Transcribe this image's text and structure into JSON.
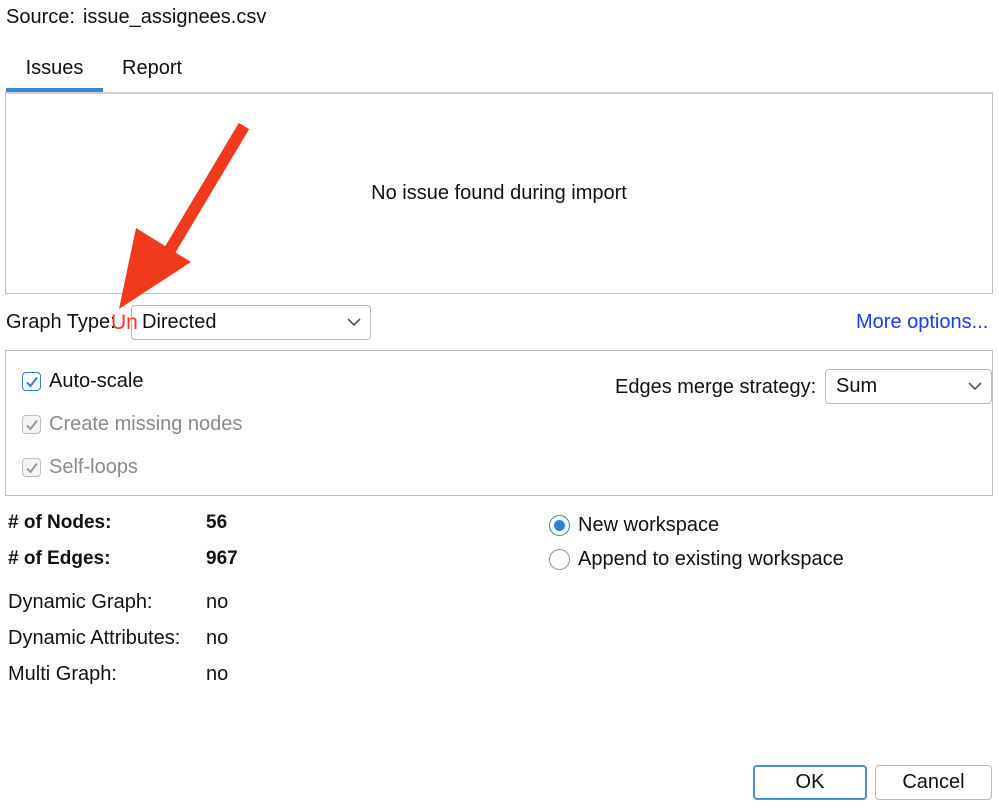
{
  "source": {
    "label": "Source:",
    "file": "issue_assignees.csv"
  },
  "tabs": [
    {
      "label": "Issues",
      "active": true
    },
    {
      "label": "Report",
      "active": false
    }
  ],
  "issues_panel": {
    "message": "No issue found during import"
  },
  "graph_type": {
    "label": "Graph Type:",
    "annotation": "Un",
    "value": "Directed"
  },
  "more_options": "More options...",
  "options": {
    "auto_scale": {
      "label": "Auto-scale",
      "checked": true,
      "enabled": true
    },
    "create_missing_nodes": {
      "label": "Create missing nodes",
      "checked": true,
      "enabled": false
    },
    "self_loops": {
      "label": "Self-loops",
      "checked": true,
      "enabled": false
    },
    "edges_merge": {
      "label": "Edges merge strategy:",
      "value": "Sum"
    }
  },
  "stats": {
    "nodes_label": "# of Nodes:",
    "nodes": "56",
    "edges_label": "# of Edges:",
    "edges": "967",
    "dynamic_graph_label": "Dynamic Graph:",
    "dynamic_graph": "no",
    "dynamic_attributes_label": "Dynamic Attributes:",
    "dynamic_attributes": "no",
    "multi_graph_label": "Multi Graph:",
    "multi_graph": "no"
  },
  "workspace": {
    "new": {
      "label": "New workspace",
      "selected": true
    },
    "append": {
      "label": "Append to existing workspace",
      "selected": false
    }
  },
  "buttons": {
    "ok": "OK",
    "cancel": "Cancel"
  },
  "colors": {
    "accent": "#2f7fd6",
    "link": "#1a3cf0",
    "annotation": "#f03a1e"
  },
  "icons": {
    "dropdown": "chevron-down-icon",
    "check": "checkmark-icon",
    "arrow": "red-arrow-annotation"
  }
}
